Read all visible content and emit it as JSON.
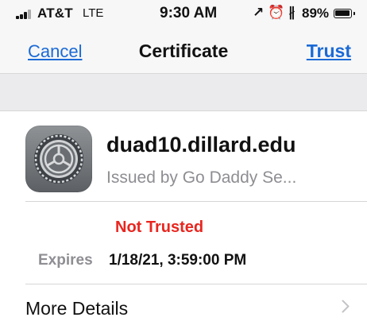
{
  "status_bar": {
    "carrier": "AT&T",
    "network": "LTE",
    "time": "9:30 AM",
    "icons": "↗ ⏰ ∦",
    "battery_percent": "89%",
    "battery_level": 0.89
  },
  "nav": {
    "left_label": "Cancel",
    "title": "Certificate",
    "right_label": "Trust"
  },
  "certificate": {
    "icon": "settings-gear-icon",
    "name": "duad10.dillard.edu",
    "issuer": "Issued by Go Daddy Se...",
    "trust_status": "Not Trusted",
    "expires_label": "Expires",
    "expires_value": "1/18/21, 3:59:00 PM",
    "more_details_label": "More Details"
  },
  "colors": {
    "accent": "#1b6ad6",
    "not_trusted": "#e8261f",
    "secondary_text": "#8e8e93",
    "group_background": "#ebebed"
  }
}
